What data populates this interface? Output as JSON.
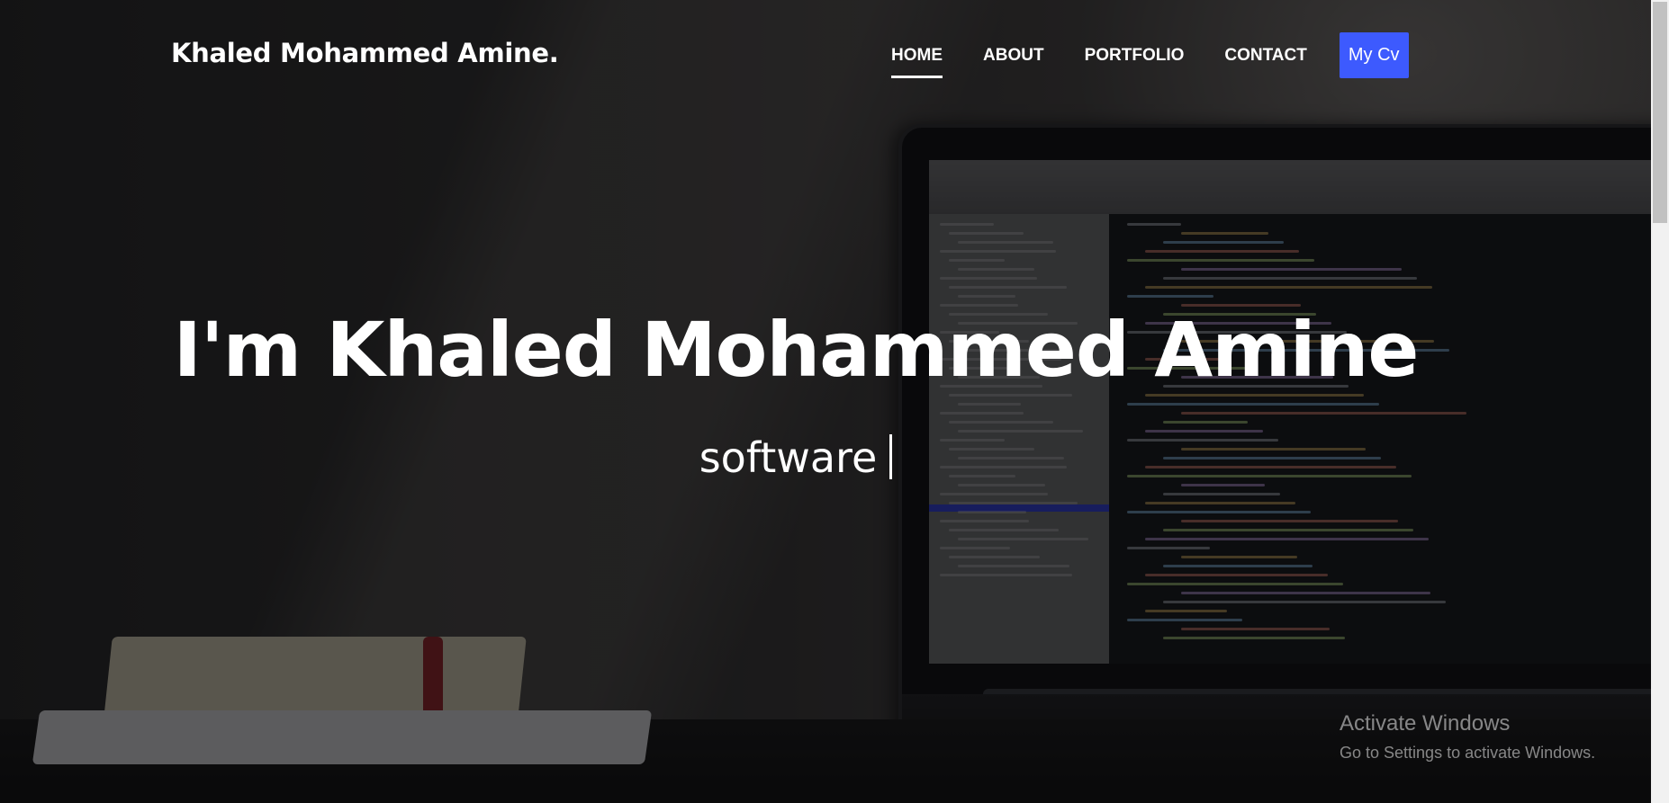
{
  "header": {
    "brand": "Khaled Mohammed Amine.",
    "nav": [
      {
        "label": "HOME",
        "active": true
      },
      {
        "label": "ABOUT",
        "active": false
      },
      {
        "label": "PORTFOLIO",
        "active": false
      },
      {
        "label": "CONTACT",
        "active": false
      }
    ],
    "cv_button": "My Cv",
    "cv_button_color": "#3d5afe"
  },
  "hero": {
    "title": "I'm Khaled Mohammed Amine",
    "typed_text": "software"
  },
  "watermark": {
    "title": "Activate Windows",
    "subtitle": "Go to Settings to activate Windows."
  }
}
